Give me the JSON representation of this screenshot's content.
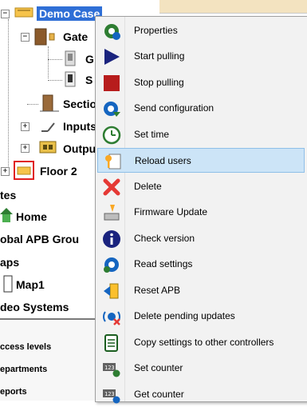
{
  "tree": {
    "root_label": "Demo Case",
    "gate_label": "Gate",
    "gate_child1": "G",
    "gate_child2": "S",
    "sections_label": "Sectio",
    "inputs_label": "Inputs",
    "outputs_label": "Outpu",
    "floor2_label": "Floor 2",
    "sites_label": "tes",
    "home_label": "Home",
    "apb_label": "obal APB Grou",
    "maps_label": "aps",
    "map1_label": "Map1",
    "video_label": "deo Systems"
  },
  "lower_pane": {
    "items": [
      "ccess levels",
      "epartments",
      "eports"
    ]
  },
  "context_menu": {
    "highlighted_index": 5,
    "items": [
      {
        "label": "Properties",
        "icon": "gear-icon"
      },
      {
        "label": "Start pulling",
        "icon": "play-icon"
      },
      {
        "label": "Stop pulling",
        "icon": "stop-icon"
      },
      {
        "label": "Send configuration",
        "icon": "gear-send-icon"
      },
      {
        "label": "Set time",
        "icon": "clock-icon"
      },
      {
        "label": "Reload users",
        "icon": "key-card-icon"
      },
      {
        "label": "Delete",
        "icon": "delete-x-icon"
      },
      {
        "label": "Firmware Update",
        "icon": "firmware-icon"
      },
      {
        "label": "Check version",
        "icon": "info-icon"
      },
      {
        "label": "Read settings",
        "icon": "gear-read-icon"
      },
      {
        "label": "Reset APB",
        "icon": "reset-apb-icon"
      },
      {
        "label": "Delete pending updates",
        "icon": "pending-delete-icon"
      },
      {
        "label": "Copy settings to other controllers",
        "icon": "copy-doc-icon"
      },
      {
        "label": "Set counter",
        "icon": "counter-set-icon"
      },
      {
        "label": "Get counter",
        "icon": "counter-get-icon"
      }
    ]
  },
  "colors": {
    "selection": "#2f6fd6",
    "menu_bg": "#f2f2f2",
    "menu_highlight": "#cce4f7"
  }
}
